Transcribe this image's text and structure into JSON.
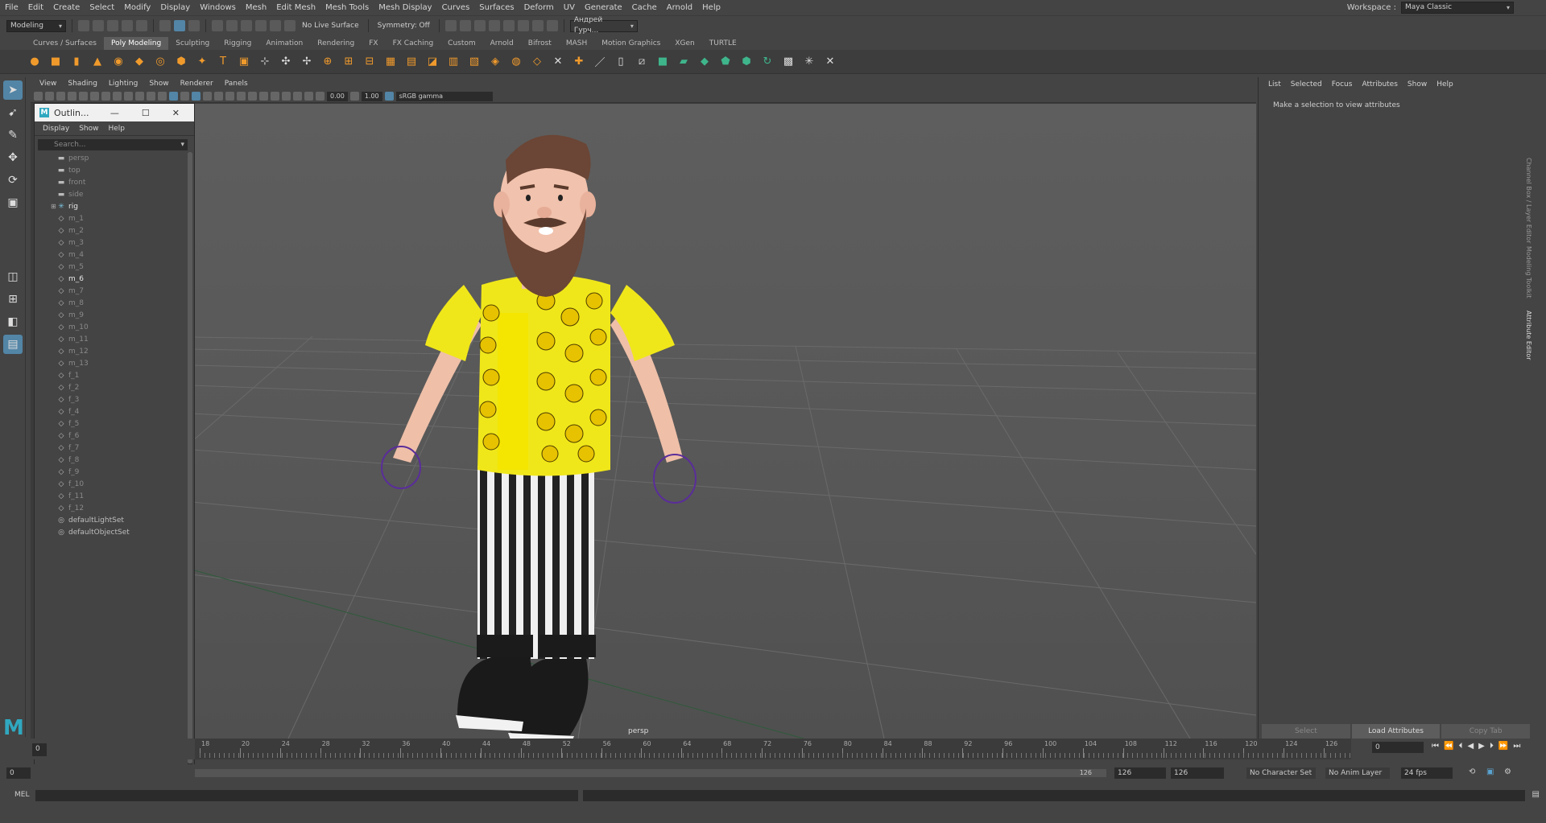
{
  "menubar": {
    "items": [
      "File",
      "Edit",
      "Create",
      "Select",
      "Modify",
      "Display",
      "Windows",
      "Mesh",
      "Edit Mesh",
      "Mesh Tools",
      "Mesh Display",
      "Curves",
      "Surfaces",
      "Deform",
      "UV",
      "Generate",
      "Cache",
      "Arnold",
      "Help"
    ],
    "workspace_label": "Workspace :",
    "workspace_value": "Maya Classic"
  },
  "statusline": {
    "menu_set": "Modeling",
    "live_surface": "No Live Surface",
    "symmetry": "Symmetry: Off",
    "user": "Андрей Гурч..."
  },
  "shelf": {
    "tabs": [
      "Curves / Surfaces",
      "Poly Modeling",
      "Sculpting",
      "Rigging",
      "Animation",
      "Rendering",
      "FX",
      "FX Caching",
      "Custom",
      "Arnold",
      "Bifrost",
      "MASH",
      "Motion Graphics",
      "XGen",
      "TURTLE"
    ],
    "active_tab": "Poly Modeling"
  },
  "viewport": {
    "menu": [
      "View",
      "Shading",
      "Lighting",
      "Show",
      "Renderer",
      "Panels"
    ],
    "exposure": "0.00",
    "gamma": "1.00",
    "color_space": "sRGB gamma",
    "camera_label": "persp"
  },
  "outliner": {
    "title": "Outlin...",
    "menu": [
      "Display",
      "Show",
      "Help"
    ],
    "search_placeholder": "Search...",
    "items": [
      {
        "label": "persp",
        "icon": "camera-icon",
        "style": "dim"
      },
      {
        "label": "top",
        "icon": "camera-icon",
        "style": "dim"
      },
      {
        "label": "front",
        "icon": "camera-icon",
        "style": "dim"
      },
      {
        "label": "side",
        "icon": "camera-icon",
        "style": "dim"
      },
      {
        "label": "rig",
        "icon": "joint-icon",
        "style": "bright",
        "expandable": true
      },
      {
        "label": "m_1",
        "icon": "mesh-icon",
        "style": "dim"
      },
      {
        "label": "m_2",
        "icon": "mesh-icon",
        "style": "dim"
      },
      {
        "label": "m_3",
        "icon": "mesh-icon",
        "style": "dim"
      },
      {
        "label": "m_4",
        "icon": "mesh-icon",
        "style": "dim"
      },
      {
        "label": "m_5",
        "icon": "mesh-icon",
        "style": "dim"
      },
      {
        "label": "m_6",
        "icon": "mesh-icon",
        "style": "bright"
      },
      {
        "label": "m_7",
        "icon": "mesh-icon",
        "style": "dim"
      },
      {
        "label": "m_8",
        "icon": "mesh-icon",
        "style": "dim"
      },
      {
        "label": "m_9",
        "icon": "mesh-icon",
        "style": "dim"
      },
      {
        "label": "m_10",
        "icon": "mesh-icon",
        "style": "dim"
      },
      {
        "label": "m_11",
        "icon": "mesh-icon",
        "style": "dim"
      },
      {
        "label": "m_12",
        "icon": "mesh-icon",
        "style": "dim"
      },
      {
        "label": "m_13",
        "icon": "mesh-icon",
        "style": "dim"
      },
      {
        "label": "f_1",
        "icon": "mesh-icon",
        "style": "dim"
      },
      {
        "label": "f_2",
        "icon": "mesh-icon",
        "style": "dim"
      },
      {
        "label": "f_3",
        "icon": "mesh-icon",
        "style": "dim"
      },
      {
        "label": "f_4",
        "icon": "mesh-icon",
        "style": "dim"
      },
      {
        "label": "f_5",
        "icon": "mesh-icon",
        "style": "dim"
      },
      {
        "label": "f_6",
        "icon": "mesh-icon",
        "style": "dim"
      },
      {
        "label": "f_7",
        "icon": "mesh-icon",
        "style": "dim"
      },
      {
        "label": "f_8",
        "icon": "mesh-icon",
        "style": "dim"
      },
      {
        "label": "f_9",
        "icon": "mesh-icon",
        "style": "dim"
      },
      {
        "label": "f_10",
        "icon": "mesh-icon",
        "style": "dim"
      },
      {
        "label": "f_11",
        "icon": "mesh-icon",
        "style": "dim"
      },
      {
        "label": "f_12",
        "icon": "mesh-icon",
        "style": "dim"
      },
      {
        "label": "defaultLightSet",
        "icon": "set-icon",
        "style": "normal"
      },
      {
        "label": "defaultObjectSet",
        "icon": "set-icon",
        "style": "normal"
      }
    ]
  },
  "attribute_editor": {
    "menu": [
      "List",
      "Selected",
      "Focus",
      "Attributes",
      "Show",
      "Help"
    ],
    "message": "Make a selection to view attributes",
    "buttons": [
      "Select",
      "Load Attributes",
      "Copy Tab"
    ],
    "side_tabs": [
      "Channel Box / Layer Editor",
      "Modeling Toolkit",
      "Attribute Editor"
    ]
  },
  "timeslider": {
    "tick_labels": [
      "18",
      "20",
      "24",
      "28",
      "32",
      "36",
      "40",
      "44",
      "48",
      "52",
      "56",
      "60",
      "64",
      "68",
      "72",
      "76",
      "80",
      "84",
      "88",
      "92",
      "96",
      "100",
      "104",
      "108",
      "112",
      "116",
      "120",
      "124",
      "126"
    ],
    "current_frame": "0",
    "start_field": "0",
    "left_box": "0"
  },
  "rangeslider": {
    "start": "0",
    "range_end_marker": "126",
    "end": "126",
    "max": "126",
    "character_set": "No Character Set",
    "anim_layer": "No Anim Layer",
    "fps": "24 fps"
  },
  "cmdline": {
    "label": "MEL"
  }
}
